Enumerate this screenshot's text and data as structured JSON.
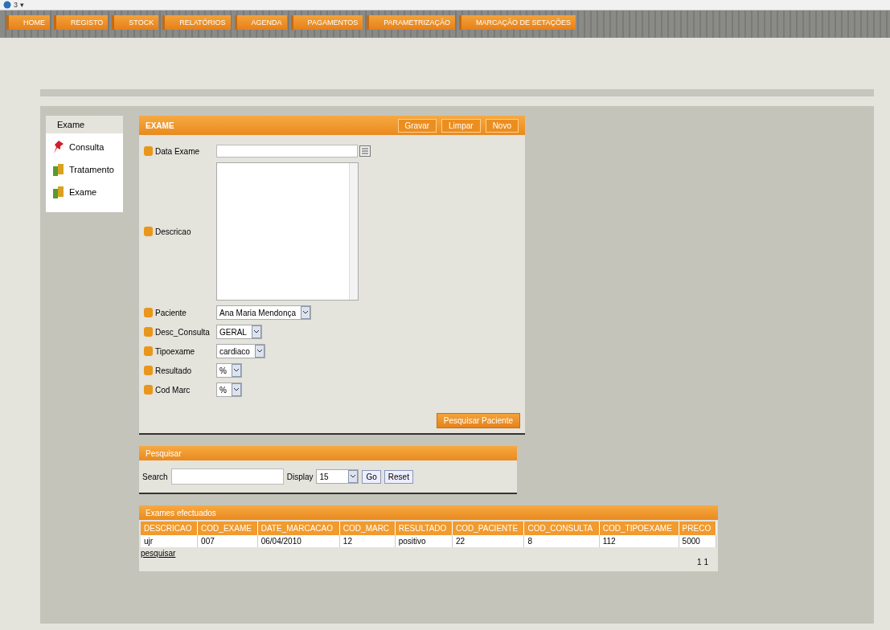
{
  "browser": {
    "tab_title": "3 ▾"
  },
  "nav": [
    {
      "label": "HOME",
      "selected": false
    },
    {
      "label": "REGISTO",
      "selected": false
    },
    {
      "label": "STOCK",
      "selected": false
    },
    {
      "label": "RELATÓRIOS",
      "selected": false
    },
    {
      "label": "AGENDA",
      "selected": false
    },
    {
      "label": "PAGAMENTOS",
      "selected": false
    },
    {
      "label": "PARAMETRIZAÇÃO",
      "selected": false
    },
    {
      "label": "MARCAÇÃO DE SETAÇÕES",
      "selected": false
    }
  ],
  "sidebar": {
    "title": "Exame",
    "items": [
      {
        "label": "Consulta",
        "kind": "pin"
      },
      {
        "label": "Tratamento",
        "kind": "books"
      },
      {
        "label": "Exame",
        "kind": "books"
      }
    ]
  },
  "form": {
    "title": "EXAME",
    "buttons": [
      "Gravar",
      "Limpar",
      "Novo"
    ],
    "fields": [
      {
        "label": "Data Exame",
        "kind": "date"
      },
      {
        "label": "Descricao",
        "kind": "textarea"
      },
      {
        "label": "Paciente",
        "kind": "select",
        "value": "Ana Maria Mendonça"
      },
      {
        "label": "Desc_Consulta",
        "kind": "select",
        "value": "GERAL"
      },
      {
        "label": "Tipoexame",
        "kind": "select",
        "value": "cardiaco"
      },
      {
        "label": "Resultado",
        "kind": "select",
        "value": "%"
      },
      {
        "label": "Cod Marc",
        "kind": "select",
        "value": "%"
      }
    ],
    "action": "Pesquisar Paciente"
  },
  "search": {
    "title": "Pesquisar",
    "search_label": "Search",
    "display_label": "Display",
    "display_value": "15",
    "go": "Go",
    "reset": "Reset"
  },
  "results": {
    "title": "Exames efectuados",
    "columns": [
      "DESCRICAO",
      "COD_EXAME",
      "DATE_MARCACAO",
      "COD_MARC",
      "RESULTADO",
      "COD_PACIENTE",
      "COD_CONSULTA",
      "COD_TIPOEXAME",
      "PRECO"
    ],
    "rows": [
      [
        "ujr",
        "007",
        "06/04/2010",
        "12",
        "positivo",
        "22",
        "8",
        "112",
        "5000"
      ]
    ],
    "link": "pesquisar",
    "pages": "1 1"
  }
}
